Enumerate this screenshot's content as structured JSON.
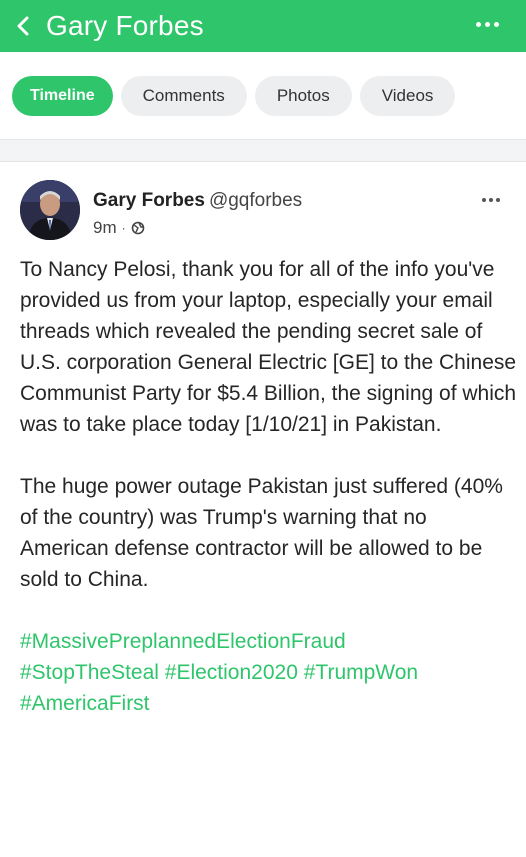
{
  "header": {
    "title": "Gary Forbes",
    "back_icon": "chevron-left-icon",
    "more_icon": "more-horizontal-icon"
  },
  "tabs": [
    {
      "label": "Timeline",
      "active": true
    },
    {
      "label": "Comments",
      "active": false
    },
    {
      "label": "Photos",
      "active": false
    },
    {
      "label": "Videos",
      "active": false
    }
  ],
  "post": {
    "author_name": "Gary Forbes",
    "handle": "@gqforbes",
    "time": "9m",
    "visibility_icon": "globe-icon",
    "paragraph1": "To Nancy Pelosi, thank you for all of the info you've provided us from your laptop, especially your email threads which revealed the pending secret sale of U.S. corporation General Electric [GE] to the Chinese Communist Party for $5.4 Billion, the signing of which was to take place today [1/10/21] in Pakistan.",
    "paragraph2": "The huge power outage Pakistan just suffered (40% of the country) was Trump's warning that no American defense contractor will be allowed to be sold to China.",
    "hashtags": [
      "#MassivePreplannedElectionFraud",
      "#StopTheSteal",
      "#Election2020",
      "#TrumpWon",
      "#AmericaFirst"
    ]
  },
  "colors": {
    "brand_green": "#2fc56b",
    "tab_inactive_bg": "#eceeef",
    "text": "#262626"
  }
}
